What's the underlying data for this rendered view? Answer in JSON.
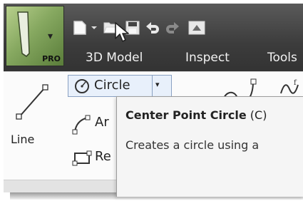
{
  "app": {
    "badge": "PRO"
  },
  "quick_access": {
    "icons": [
      "new-icon",
      "new-dropdown-icon",
      "open-icon",
      "save-icon",
      "undo-icon",
      "redo-icon",
      "update-icon"
    ]
  },
  "tabs": [
    {
      "label": "3D Model"
    },
    {
      "label": "Inspect"
    },
    {
      "label": "Tools"
    }
  ],
  "ribbon": {
    "line_label": "Line",
    "circle_label": "Circle",
    "arc_label": "Ar",
    "rect_label": "Re"
  },
  "tooltip": {
    "title": "Center Point Circle",
    "shortcut": "(C)",
    "description": "Creates a circle using a"
  },
  "colors": {
    "titlebar": "#3c3c3c",
    "app_button": "#86a860",
    "highlight": "#e8f0fb",
    "highlight_border": "#8aa1c2"
  }
}
